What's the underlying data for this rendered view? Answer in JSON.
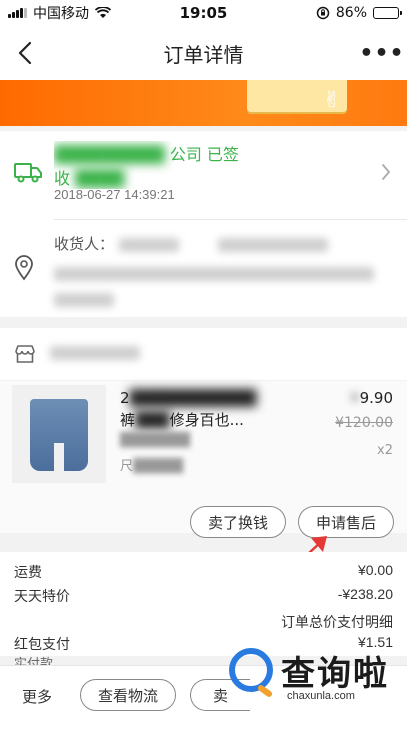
{
  "status_bar": {
    "carrier": "中国移动",
    "time": "19:05",
    "battery": "86%",
    "battery_level": 0.86
  },
  "nav": {
    "title": "订单详情",
    "more": "•••"
  },
  "logistics": {
    "status_suffix": "公司 已签",
    "status_prefix": "收",
    "time": "2018-06-27 14:39:21"
  },
  "address": {
    "receiver_label": "收货人："
  },
  "item": {
    "title_prefix": "2",
    "title_line2_start": "裤",
    "title_line2_end": "修身百也...",
    "sku_prefix": "尺",
    "price": "9.90",
    "original_price": "¥120.00",
    "quantity": "x2"
  },
  "buttons": {
    "resell": "卖了换钱",
    "after_sale": "申请售后",
    "more": "更多",
    "view_logistics": "查看物流",
    "sell_partial": "卖"
  },
  "fees": {
    "rows": [
      {
        "label": "运费",
        "value": "¥0.00"
      },
      {
        "label": "天天特价",
        "value": "-¥238.20"
      },
      {
        "label": "红包支付",
        "value": "¥1.51"
      }
    ],
    "total_detail_link": "订单总价支付明细",
    "partial_row": "实付款"
  },
  "watermark": {
    "text": "查询啦",
    "domain": "chaxunla.com"
  },
  "colors": {
    "accent_green": "#3bb34a",
    "banner_orange": "#ff6a00",
    "watermark_blue": "#2a7be0"
  }
}
